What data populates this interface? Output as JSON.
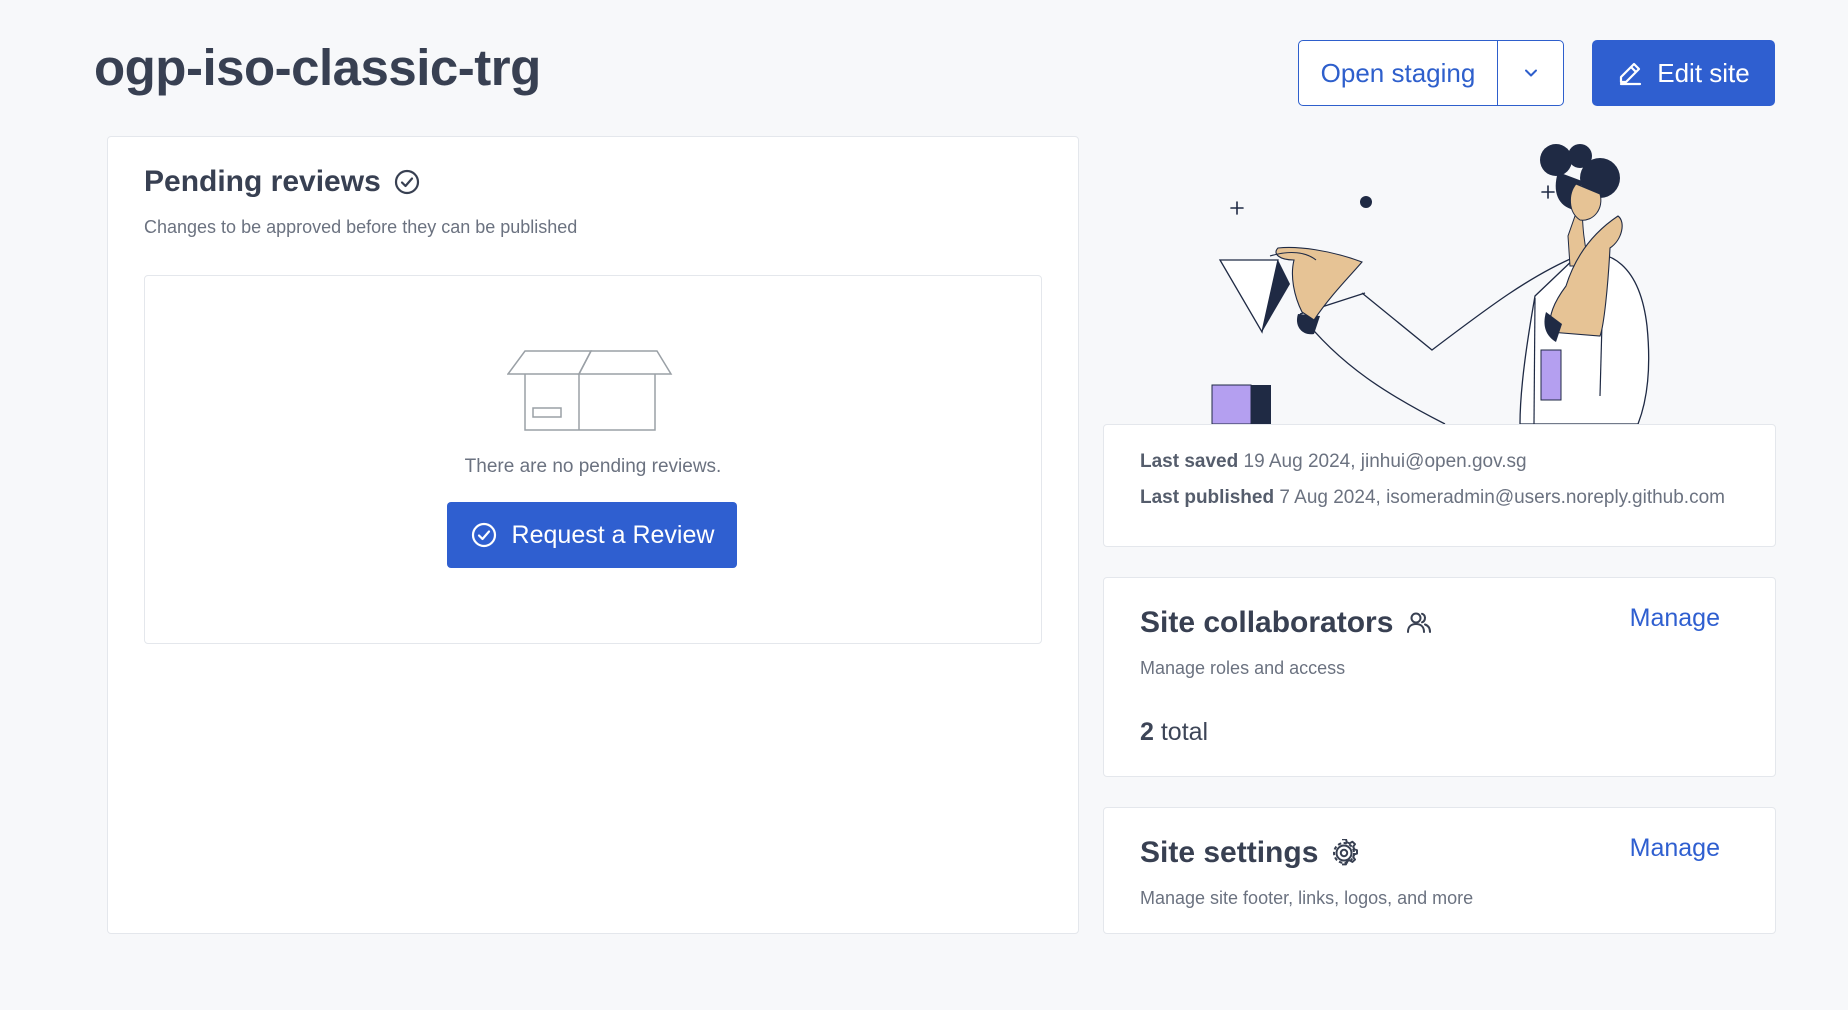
{
  "header": {
    "site_name": "ogp-iso-classic-trg",
    "open_staging_label": "Open staging",
    "edit_site_label": "Edit site"
  },
  "pending_reviews": {
    "title": "Pending reviews",
    "subtitle": "Changes to be approved before they can be published",
    "empty_text": "There are no pending reviews.",
    "request_button_label": "Request a Review"
  },
  "site_status": {
    "last_saved_label": "Last saved",
    "last_saved_value": "19 Aug 2024, jinhui@open.gov.sg",
    "last_published_label": "Last published",
    "last_published_value": "7 Aug 2024, isomeradmin@users.noreply.github.com"
  },
  "collaborators": {
    "title": "Site collaborators",
    "subtitle": "Manage roles and access",
    "manage_label": "Manage",
    "total_count": "2",
    "total_suffix": "total"
  },
  "settings": {
    "title": "Site settings",
    "subtitle": "Manage site footer, links, logos, and more",
    "manage_label": "Manage"
  },
  "icons": {
    "check_circle": "check-circle-icon",
    "chevron_down": "chevron-down-icon",
    "pencil": "pencil-icon",
    "users": "users-icon",
    "gear": "gear-icon",
    "empty_box": "empty-box-icon"
  },
  "colors": {
    "primary": "#2f5fd0",
    "background": "#f7f8fa",
    "card": "#ffffff",
    "text": "#384052"
  }
}
